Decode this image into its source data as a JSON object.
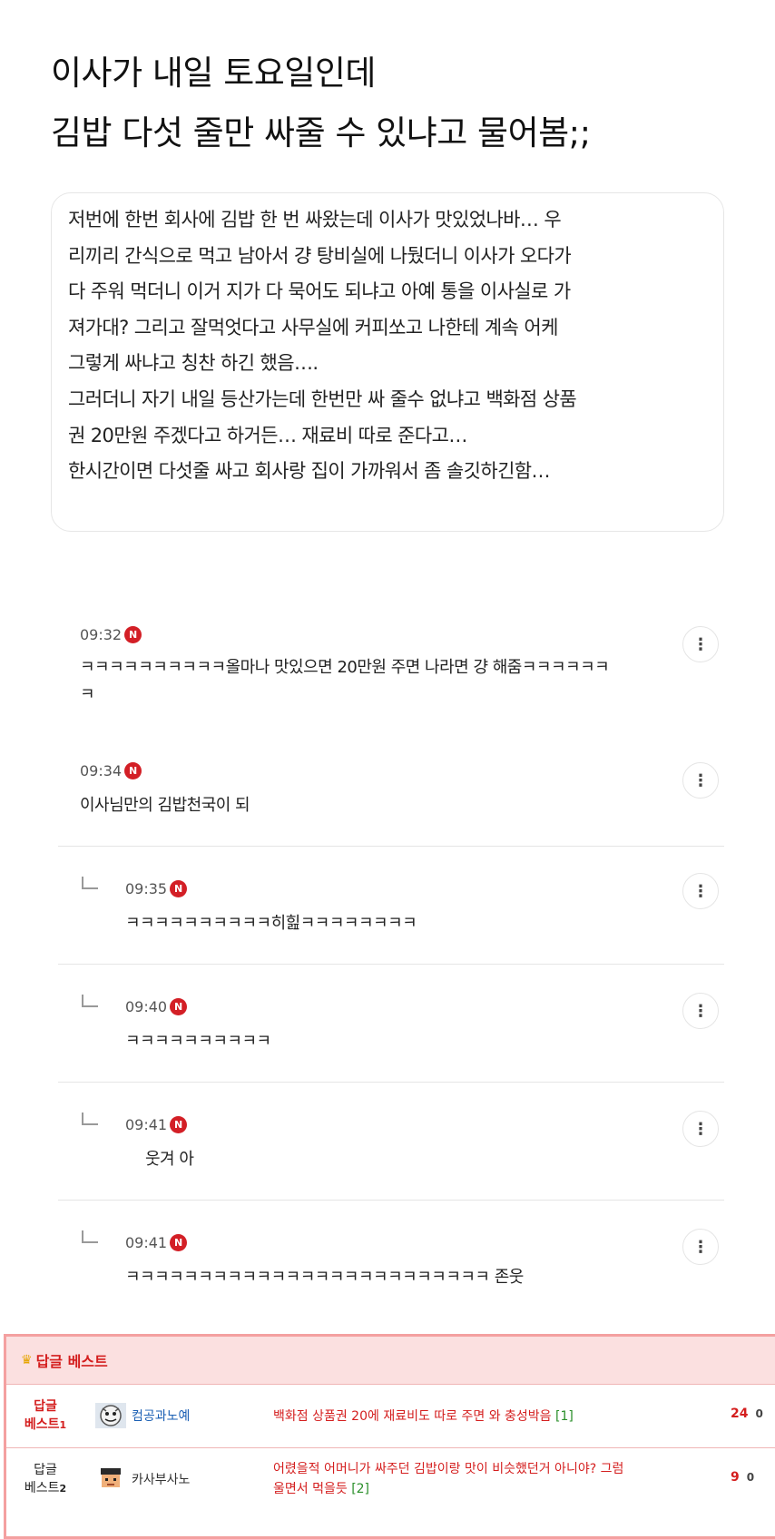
{
  "title": {
    "line1": "이사가 내일 토요일인데",
    "line2": "김밥 다섯 줄만 싸줄 수 있냐고 물어봄;;"
  },
  "post": {
    "lines": [
      "저번에 한번 회사에 김밥 한 번 싸왔는데 이사가 맛있었나바… 우",
      "리끼리 간식으로 먹고 남아서 걍 탕비실에 나뒀더니 이사가 오다가",
      "다 주워 먹더니 이거 지가 다 묵어도 되냐고 아예 통을 이사실로 가",
      "져가대? 그리고 잘먹엇다고 사무실에 커피쏘고 나한테 계속 어케",
      "그렇게 싸냐고 칭찬 하긴 했음….",
      "그러더니 자기 내일 등산가는데 한번만 싸 줄수 없냐고 백화점 상품",
      "권 20만원 주겠다고 하거든… 재료비 따로 준다고…",
      "한시간이면 다섯줄 싸고 회사랑 집이 가까워서 좀 솔깃하긴함…"
    ]
  },
  "comments": [
    {
      "time": "09:32",
      "badge": "N",
      "text1": "ㅋㅋㅋㅋㅋㅋㅋㅋㅋㅋ올마나 맛있으면 20만원 주면 나라면 걍 해줌ㅋㅋㅋㅋㅋㅋ",
      "text2": "ㅋ"
    },
    {
      "time": "09:34",
      "badge": "N",
      "text1": "이사님만의 김밥천국이 되"
    },
    {
      "time": "09:35",
      "badge": "N",
      "text1": "ㅋㅋㅋㅋㅋㅋㅋㅋㅋㅋ히힖ㅋㅋㅋㅋㅋㅋㅋㅋ"
    },
    {
      "time": "09:40",
      "badge": "N",
      "text1": "ㅋㅋㅋㅋㅋㅋㅋㅋㅋㅋ"
    },
    {
      "time": "09:41",
      "badge": "N",
      "text1": "웃겨 아"
    },
    {
      "time": "09:41",
      "badge": "N",
      "text1": "ㅋㅋㅋㅋㅋㅋㅋㅋㅋㅋㅋㅋㅋㅋㅋㅋㅋㅋㅋㅋㅋㅋㅋㅋㅋ 존웃"
    }
  ],
  "more_glyph": "⋮",
  "best": {
    "header": "답글 베스트",
    "medal_icon": "medal-icon",
    "rows": [
      {
        "rank_top": "답글",
        "rank_bottom": "베스트",
        "rank_num": "1",
        "nick": "컴공과노예",
        "text1": "백화점 상품권 20에 재료비도 따로 주면 와 충성박음",
        "text1_cnt": "[1]",
        "text2": "",
        "text2_cnt": "",
        "up": "24",
        "down": "0"
      },
      {
        "rank_top": "답글",
        "rank_bottom": "베스트",
        "rank_num": "2",
        "nick": "카사부사노",
        "text1": "어렸을적 어머니가 싸주던 김밥이랑 맛이 비슷했던거 아니야? 그럼",
        "text1_cnt": "",
        "text2": "울면서 먹을듯",
        "text2_cnt": "[2]",
        "up": "9",
        "down": "0"
      }
    ]
  },
  "colors": {
    "accent_red": "#d41e1e",
    "badge_red": "#d31f26",
    "best_bg": "#fbe0e0",
    "nick_blue": "#1a5fb4",
    "count_green": "#2a8f2a"
  }
}
